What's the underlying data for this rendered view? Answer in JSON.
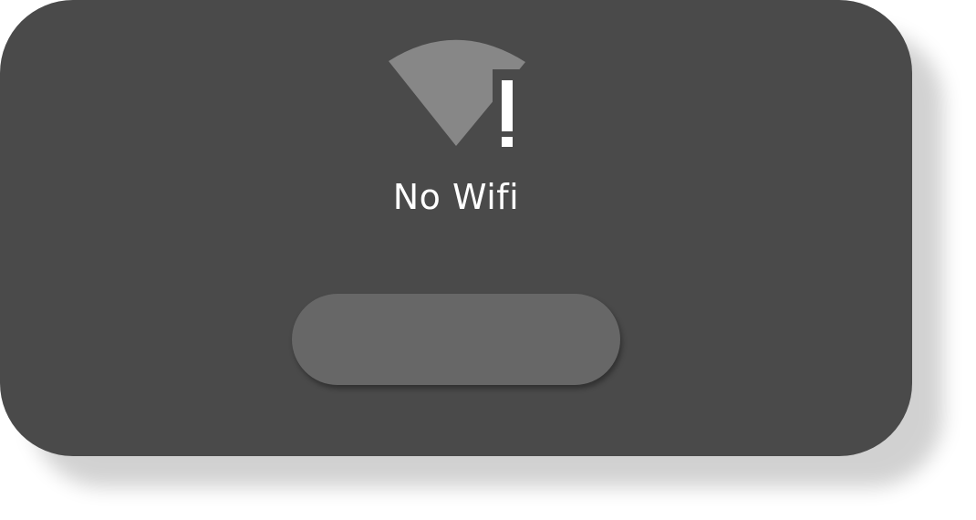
{
  "status": {
    "label": "No Wifi",
    "icon": "wifi-off-alert-icon"
  },
  "action_button": {
    "label": ""
  },
  "colors": {
    "card_background": "#4a4a4a",
    "wifi_icon_fill": "#878787",
    "alert_mark": "#ffffff",
    "button_background": "#676767",
    "text": "#ffffff"
  }
}
